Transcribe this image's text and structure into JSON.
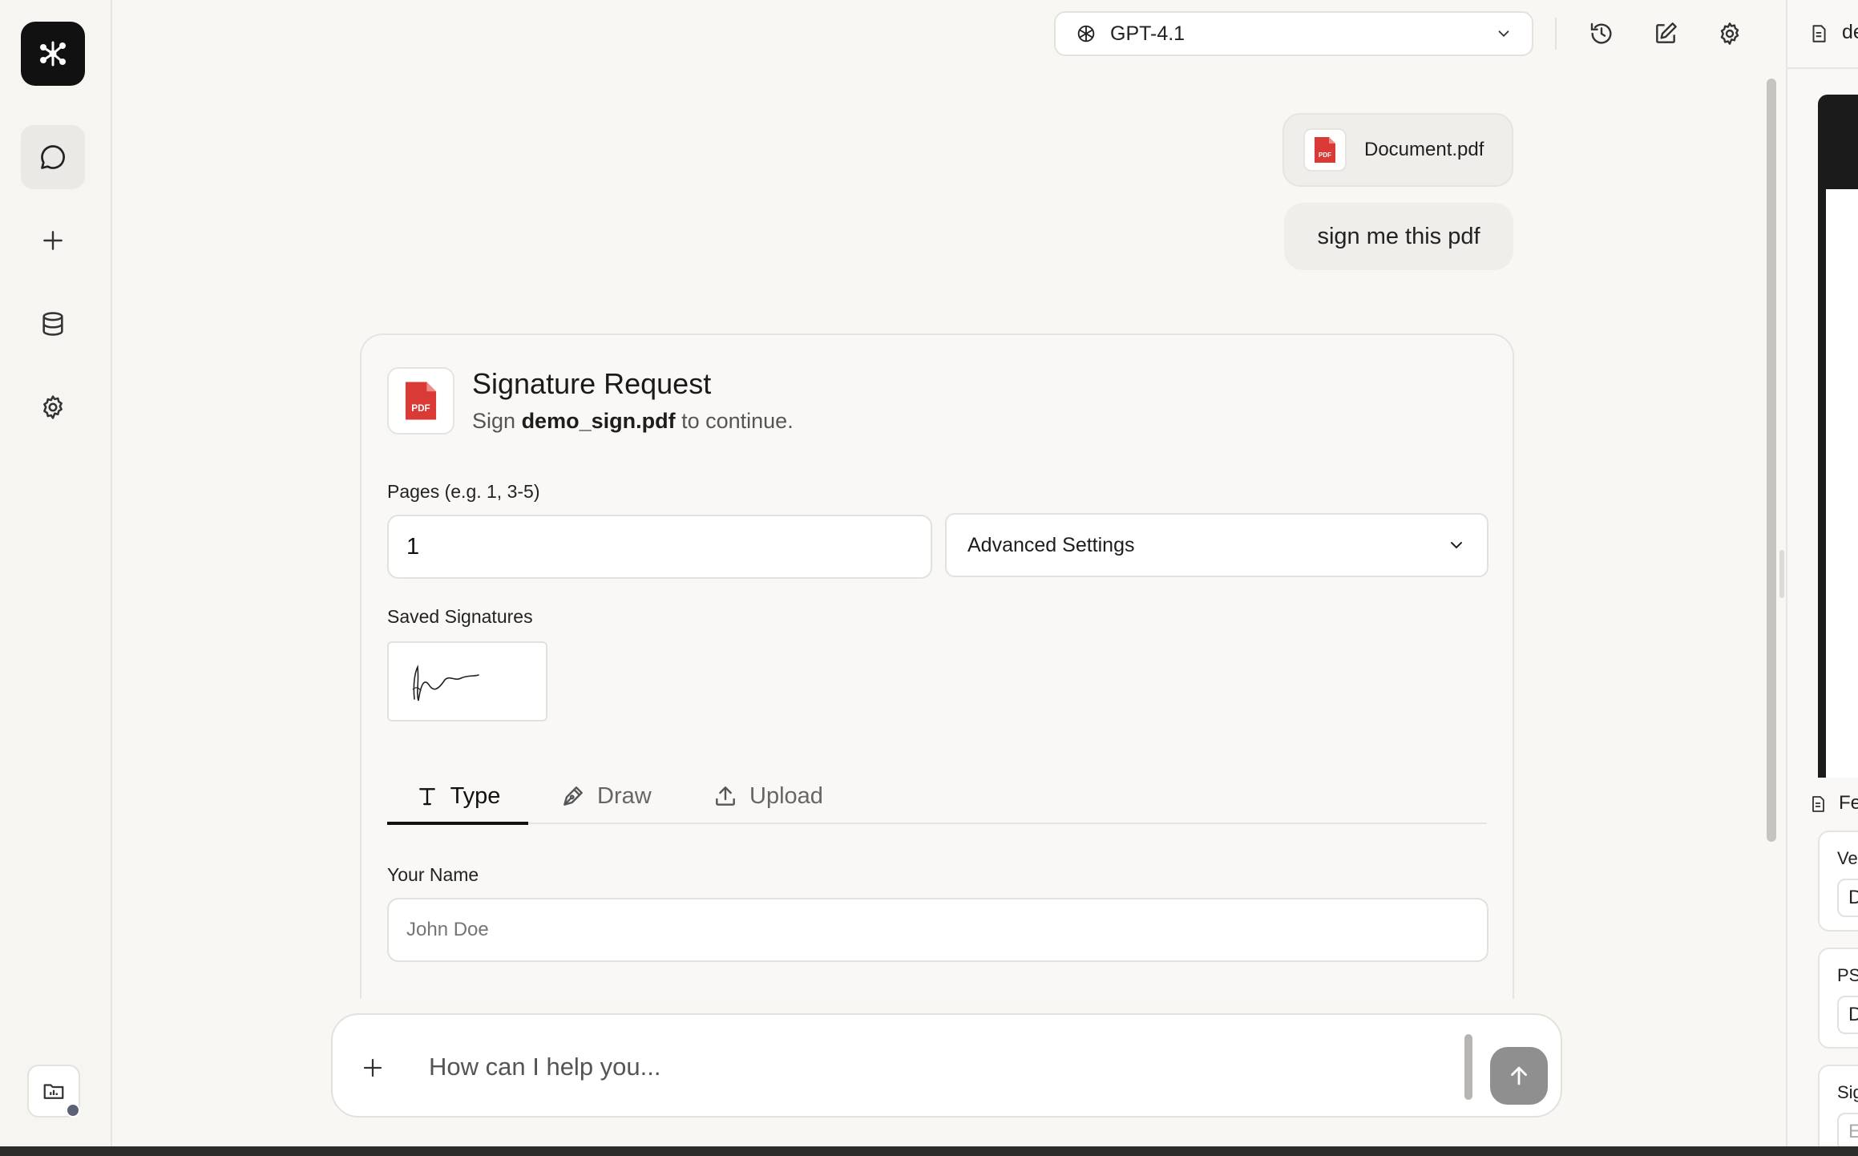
{
  "sidebar": {
    "logo": "app-logo",
    "items": [
      {
        "name": "chat",
        "icon": "chat-bubble-icon",
        "active": true
      },
      {
        "name": "new",
        "icon": "plus-icon",
        "active": false
      },
      {
        "name": "data",
        "icon": "database-icon",
        "active": false
      },
      {
        "name": "settings",
        "icon": "gear-icon",
        "active": false
      }
    ],
    "bottom_icon": "folder-chart-icon"
  },
  "topbar": {
    "model": "GPT-4.1",
    "icons": [
      "history-icon",
      "edit-icon",
      "gear-icon"
    ]
  },
  "messages": [
    {
      "type": "file",
      "file_name": "Document.pdf",
      "icon_text": "PDF"
    },
    {
      "type": "text",
      "text": "sign me this pdf"
    }
  ],
  "signature_card": {
    "icon_text": "PDF",
    "title": "Signature Request",
    "subtitle_prefix": "Sign",
    "file_name": "demo_sign.pdf",
    "subtitle_suffix": "to continue.",
    "pages_label": "Pages (e.g. 1, 3-5)",
    "pages_value": "1",
    "advanced_settings": "Advanced Settings",
    "saved_signatures_label": "Saved Signatures",
    "tabs": [
      {
        "label": "Type",
        "icon": "text-t-icon",
        "active": true
      },
      {
        "label": "Draw",
        "icon": "pen-icon",
        "active": false
      },
      {
        "label": "Upload",
        "icon": "upload-icon",
        "active": false
      }
    ],
    "name_label": "Your Name",
    "name_placeholder": "John Doe"
  },
  "composer": {
    "placeholder": "How can I help you...",
    "send_icon": "arrow-up-icon",
    "attach_icon": "plus-icon"
  },
  "right_panel": {
    "header_text": "de",
    "fields_title": "Fe",
    "cards": [
      {
        "label": "Ver",
        "value": "D"
      },
      {
        "label": "PSI",
        "value": "D"
      },
      {
        "label": "Sig",
        "value": "E"
      }
    ]
  },
  "colors": {
    "background": "#f8f7f4",
    "pdf_red": "#d93a35",
    "accent_dark": "#111111",
    "send_button": "#8f8f8f"
  }
}
